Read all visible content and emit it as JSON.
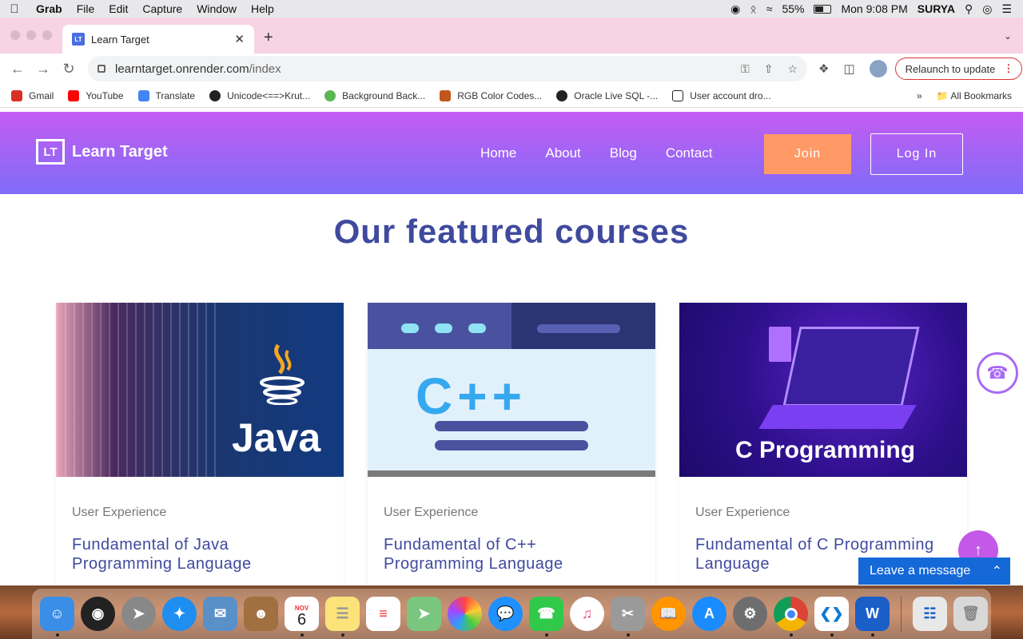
{
  "menubar": {
    "app": "Grab",
    "items": [
      "File",
      "Edit",
      "Capture",
      "Window",
      "Help"
    ],
    "battery": "55%",
    "battery_level": 0.55,
    "clock": "Mon 9:08 PM",
    "user": "SURYA"
  },
  "browser": {
    "tab_title": "Learn Target",
    "favicon_text": "LT",
    "url_host": "learntarget.onrender.com",
    "url_path": "/index",
    "relaunch_label": "Relaunch to update",
    "bookmarks": [
      {
        "label": "Gmail",
        "color": "#d93025"
      },
      {
        "label": "YouTube",
        "color": "#ff0000"
      },
      {
        "label": "Translate",
        "color": "#4285f4"
      },
      {
        "label": "Unicode<==>Krut...",
        "color": "#222222"
      },
      {
        "label": "Background Back...",
        "color": "#5ab552"
      },
      {
        "label": "RGB Color Codes...",
        "color": "#c0561b"
      },
      {
        "label": "Oracle Live SQL -...",
        "color": "#222222"
      },
      {
        "label": "User account dro...",
        "color": "#ffffff"
      }
    ],
    "all_bookmarks": "All Bookmarks"
  },
  "site": {
    "logo_mark": "LT",
    "logo_text": "Learn Target",
    "nav": [
      "Home",
      "About",
      "Blog",
      "Contact"
    ],
    "join": "Join",
    "login": "Log In"
  },
  "main": {
    "section_title": "Our featured courses",
    "courses": [
      {
        "category": "User Experience",
        "title": "Fundamental of Java Programming Language",
        "image_label": "Java"
      },
      {
        "category": "User Experience",
        "title": "Fundamental of C++ Programming Language",
        "image_label": "C++"
      },
      {
        "category": "User Experience",
        "title": "Fundamental of C Programming Language",
        "image_label": "C Programming"
      }
    ]
  },
  "widgets": {
    "leave_message": "Leave a message"
  },
  "dock": {
    "calendar_month": "NOV",
    "calendar_day": "6"
  },
  "colors": {
    "header_top": "#c55cf2",
    "header_bottom": "#7f6cf8",
    "join_button": "#ff9a66",
    "title_text": "#3f4a9e",
    "chat_widget": "#1468d8"
  }
}
